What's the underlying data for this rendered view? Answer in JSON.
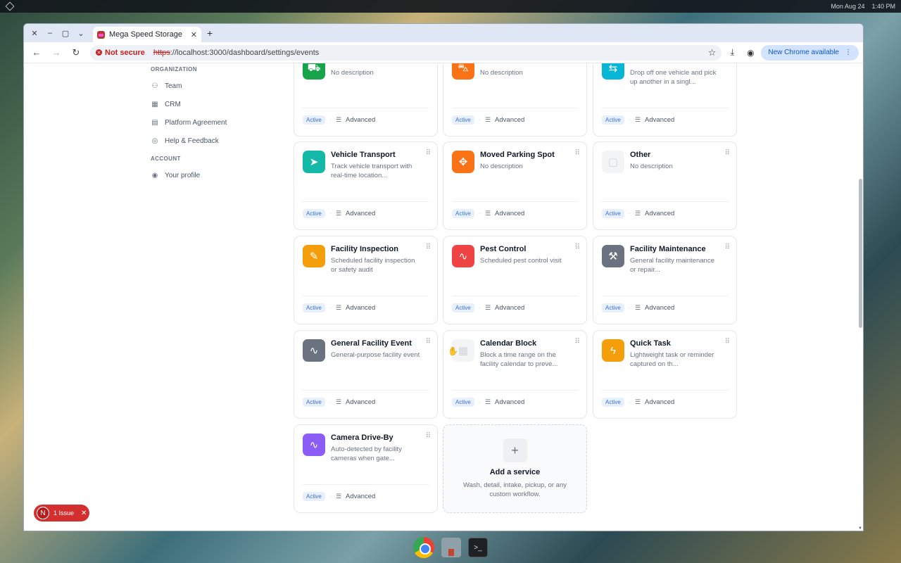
{
  "os": {
    "clock_date": "Mon Aug 24",
    "clock_time": "1:40 PM"
  },
  "browser": {
    "tab_title": "Mega Speed Storage",
    "security_label": "Not secure",
    "url_scheme": "https",
    "url_rest": "://localhost:3000/dashboard/settings/events",
    "update_label": "New Chrome available"
  },
  "sidebar": {
    "org_heading": "ORGANIZATION",
    "org_items": [
      {
        "label": "Team",
        "icon": "users-icon"
      },
      {
        "label": "CRM",
        "icon": "crm-icon"
      },
      {
        "label": "Platform Agreement",
        "icon": "document-icon"
      },
      {
        "label": "Help & Feedback",
        "icon": "help-icon"
      }
    ],
    "account_heading": "ACCOUNT",
    "account_items": [
      {
        "label": "Your profile",
        "icon": "user-circle-icon"
      }
    ]
  },
  "cards": [
    {
      "title": "",
      "desc": "No description",
      "color": "#16a34a",
      "icon": "truck-icon"
    },
    {
      "title": "",
      "desc": "No description",
      "color": "#f97316",
      "icon": "car-icon"
    },
    {
      "title": "",
      "desc": "Drop off one vehicle and pick up another in a singl...",
      "color": "#06b6d4",
      "icon": "swap-icon"
    },
    {
      "title": "Vehicle Transport",
      "desc": "Track vehicle transport with real-time location...",
      "color": "#14b8a6",
      "icon": "navigation-icon"
    },
    {
      "title": "Moved Parking Spot",
      "desc": "No description",
      "color": "#f97316",
      "icon": "move-icon"
    },
    {
      "title": "Other",
      "desc": "No description",
      "color": "#f3f4f6",
      "icon": "box-icon"
    },
    {
      "title": "Facility Inspection",
      "desc": "Scheduled facility inspection or safety audit",
      "color": "#f59e0b",
      "icon": "clipboard-icon"
    },
    {
      "title": "Pest Control",
      "desc": "Scheduled pest control visit",
      "color": "#ef4444",
      "icon": "pulse-icon"
    },
    {
      "title": "Facility Maintenance",
      "desc": "General facility maintenance or repair...",
      "color": "#6b7280",
      "icon": "hammer-icon"
    },
    {
      "title": "General Facility Event",
      "desc": "General-purpose facility event",
      "color": "#6b7280",
      "icon": "pulse-icon"
    },
    {
      "title": "Calendar Block",
      "desc": "Block a time range on the facility calendar to preve...",
      "color": "#f3f4f6",
      "icon": "calendar-icon"
    },
    {
      "title": "Quick Task",
      "desc": "Lightweight task or reminder captured on th...",
      "color": "#f59e0b",
      "icon": "bolt-icon"
    },
    {
      "title": "Camera Drive-By",
      "desc": "Auto-detected by facility cameras when gate...",
      "color": "#8b5cf6",
      "icon": "pulse-icon"
    }
  ],
  "card_common": {
    "badge": "Active",
    "advanced": "Advanced"
  },
  "add_service": {
    "title": "Add a service",
    "desc": "Wash, detail, intake, pickup, or any custom workflow."
  },
  "issue": {
    "avatar": "N",
    "label": "1 Issue"
  }
}
